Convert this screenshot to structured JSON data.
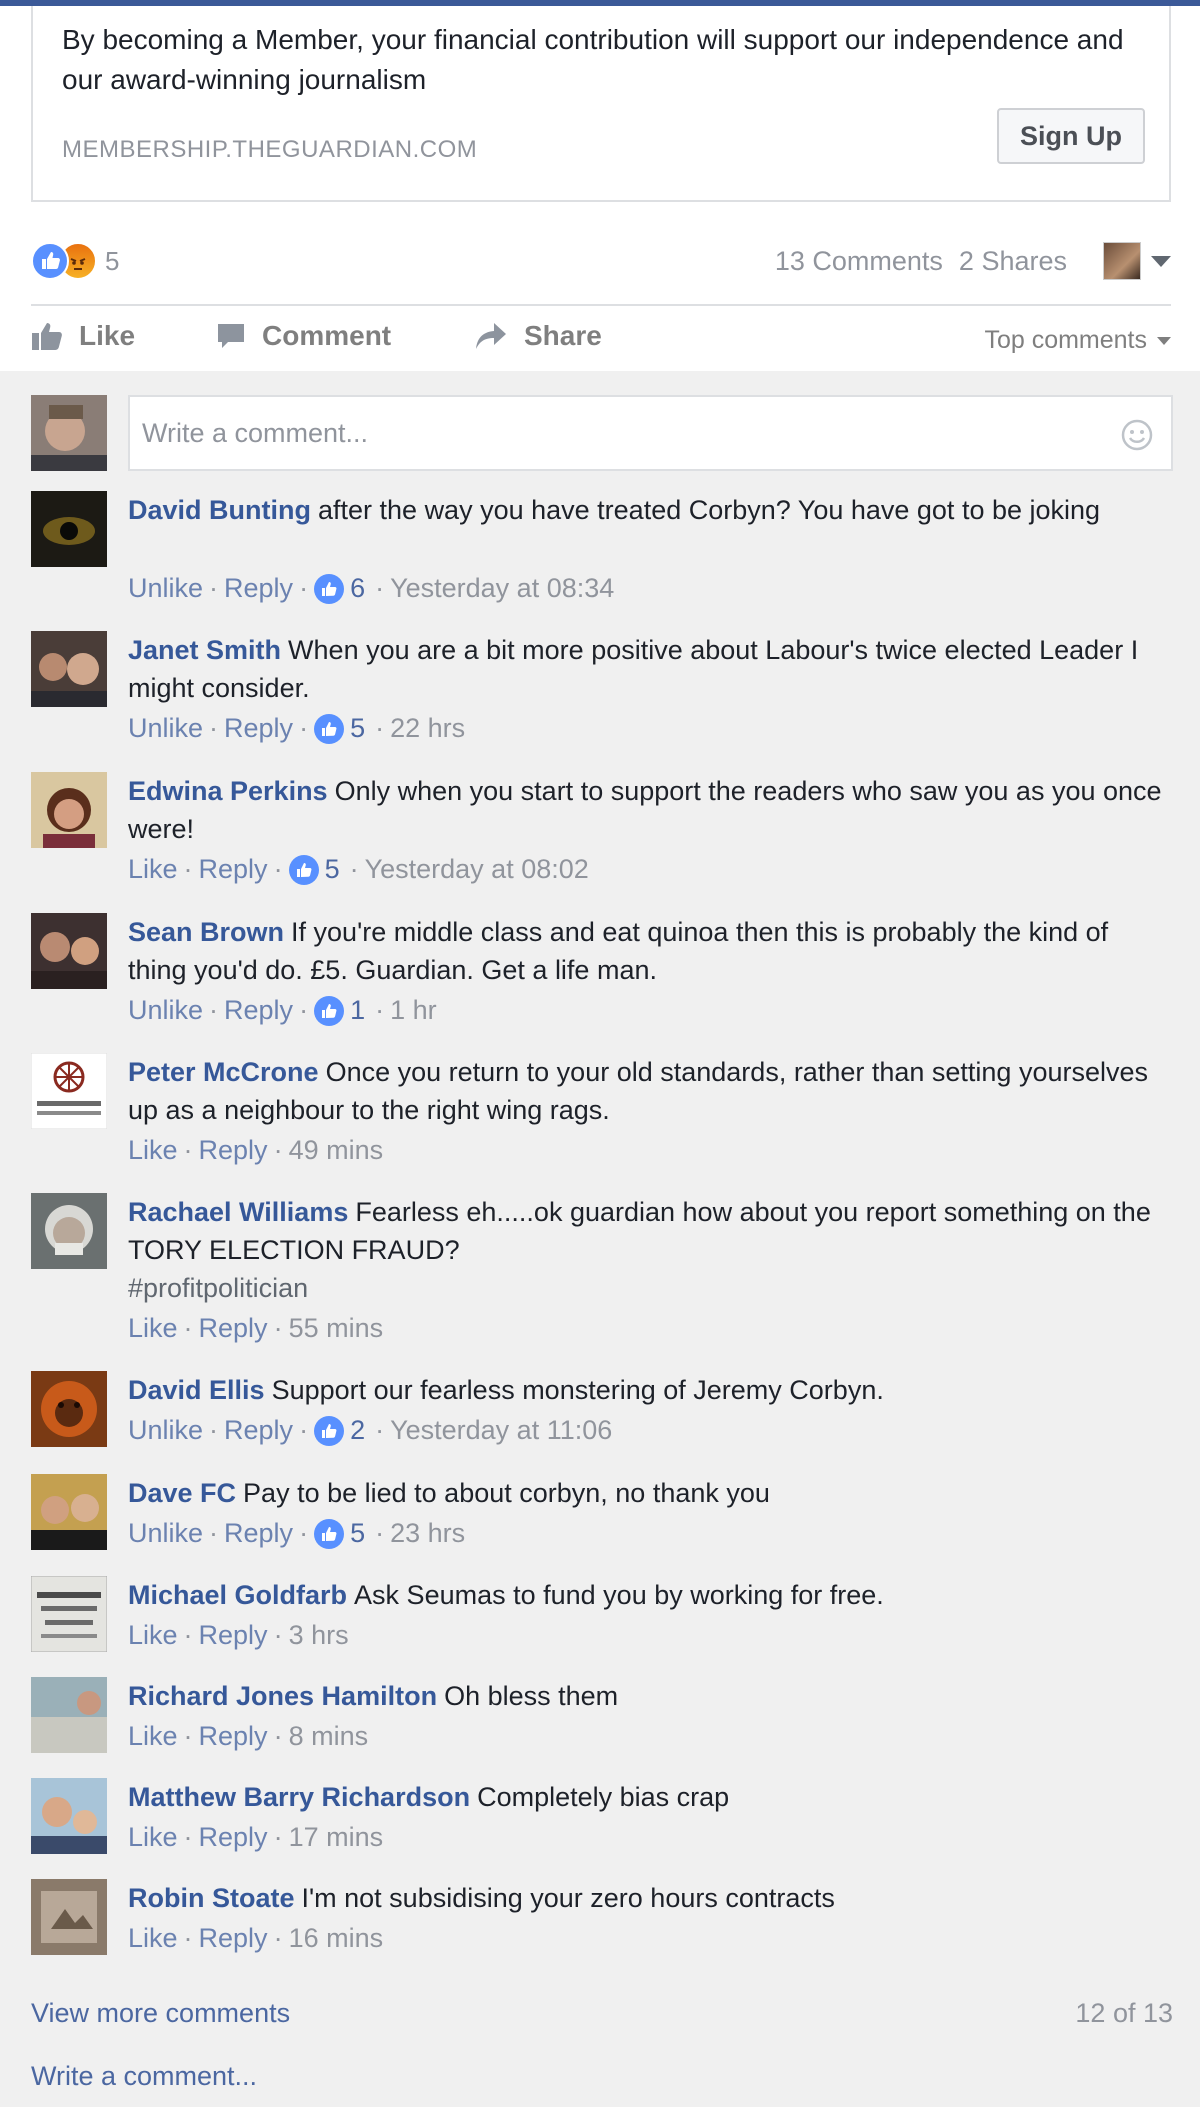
{
  "link_card": {
    "description": "By becoming a Member, your financial contribution will support our independence and our award-winning journalism",
    "domain": "MEMBERSHIP.THEGUARDIAN.COM",
    "button_label": "Sign Up"
  },
  "stats": {
    "reaction_count": "5",
    "comments": "13 Comments",
    "shares": "2 Shares"
  },
  "actions": {
    "like": "Like",
    "comment": "Comment",
    "share": "Share",
    "sort": "Top comments"
  },
  "composer": {
    "placeholder": "Write a comment..."
  },
  "comments": [
    {
      "author": "David Bunting",
      "text": "after the way you have treated Corbyn? You have got to be joking",
      "action": "Unlike",
      "reply": "Reply",
      "likes": "6",
      "time": "Yesterday at 08:34"
    },
    {
      "author": "Janet Smith",
      "text": "When you are a bit more positive about Labour's twice elected Leader I might consider.",
      "action": "Unlike",
      "reply": "Reply",
      "likes": "5",
      "time": "22 hrs"
    },
    {
      "author": "Edwina Perkins",
      "text": "Only when you start to support the readers who saw you as you once were!",
      "action": "Like",
      "reply": "Reply",
      "likes": "5",
      "time": "Yesterday at 08:02"
    },
    {
      "author": "Sean Brown",
      "text": "If you're middle class and eat quinoa then this is probably the kind of thing you'd do. £5. Guardian. Get a life man.",
      "action": "Unlike",
      "reply": "Reply",
      "likes": "1",
      "time": "1 hr"
    },
    {
      "author": "Peter McCrone",
      "text": "Once you return to your old standards, rather than setting yourselves up as a neighbour to the right wing rags.",
      "action": "Like",
      "reply": "Reply",
      "likes": "",
      "time": "49 mins"
    },
    {
      "author": "Rachael Williams",
      "text": "Fearless eh.....ok guardian how about you report something on the TORY ELECTION FRAUD?",
      "hashtag": "#profitpolitician",
      "action": "Like",
      "reply": "Reply",
      "likes": "",
      "time": "55 mins"
    },
    {
      "author": "David Ellis",
      "text": "Support our fearless monstering of Jeremy Corbyn.",
      "action": "Unlike",
      "reply": "Reply",
      "likes": "2",
      "time": "Yesterday at 11:06"
    },
    {
      "author": "Dave FC",
      "text": "Pay to be lied to about corbyn, no thank you",
      "action": "Unlike",
      "reply": "Reply",
      "likes": "5",
      "time": "23 hrs"
    },
    {
      "author": "Michael Goldfarb",
      "text": "Ask Seumas to fund you by working for free.",
      "action": "Like",
      "reply": "Reply",
      "likes": "",
      "time": "3 hrs"
    },
    {
      "author": "Richard Jones Hamilton",
      "text": "Oh bless them",
      "action": "Like",
      "reply": "Reply",
      "likes": "",
      "time": "8 mins"
    },
    {
      "author": "Matthew Barry Richardson",
      "text": "Completely bias crap",
      "action": "Like",
      "reply": "Reply",
      "likes": "",
      "time": "17 mins"
    },
    {
      "author": "Robin Stoate",
      "text": "I'm not subsidising your zero hours contracts",
      "action": "Like",
      "reply": "Reply",
      "likes": "",
      "time": "16 mins"
    }
  ],
  "footer": {
    "view_more": "View more comments",
    "count": "12 of 13",
    "write": "Write a comment..."
  },
  "icons": {
    "like_reaction": "thumbs-up-icon",
    "angry_reaction": "angry-face-icon",
    "smiley": "smiley-icon"
  },
  "colors": {
    "link": "#365899",
    "muted": "#90949c",
    "like_blue": "#5890ff",
    "header_blue": "#3b5998"
  }
}
